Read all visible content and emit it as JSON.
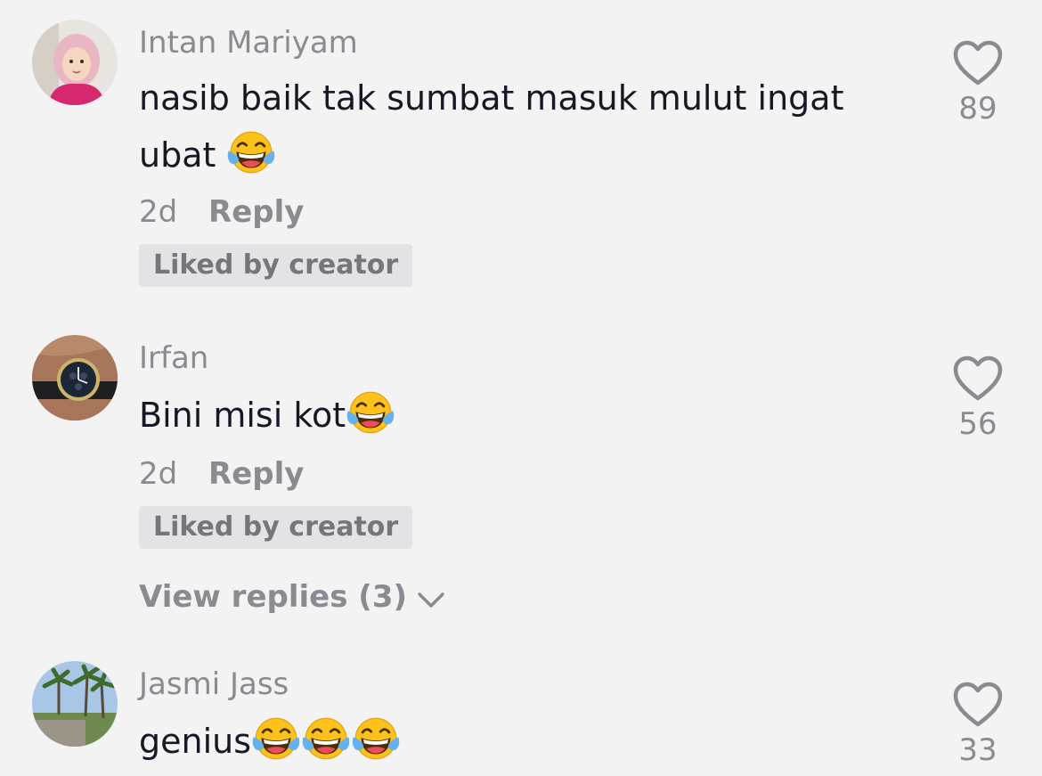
{
  "comments": [
    {
      "username": "Intan Mariyam",
      "text": "nasib baik tak sumbat masuk mulut ingat ubat",
      "text_lines": [
        "nasib baik tak sumbat masuk mulut ingat",
        "ubat"
      ],
      "emoji": "face-with-tears-of-joy",
      "time": "2d",
      "reply_label": "Reply",
      "badge": "Liked by creator",
      "likes": "89"
    },
    {
      "username": "Irfan",
      "text": "Bini misi kot",
      "emoji": "face-with-tears-of-joy",
      "time": "2d",
      "reply_label": "Reply",
      "badge": "Liked by creator",
      "view_replies": "View replies (3)",
      "likes": "56"
    },
    {
      "username": "Jasmi Jass",
      "text": "genius",
      "emoji": "face-with-tears-of-joy x3",
      "likes": "33"
    }
  ],
  "icons": {
    "like": "heart-outline-icon",
    "expand": "chevron-down-icon"
  },
  "colors": {
    "background": "#f3f3f4",
    "text": "#161823",
    "secondary": "#8a8b91",
    "badge_bg": "#e3e3e5"
  }
}
